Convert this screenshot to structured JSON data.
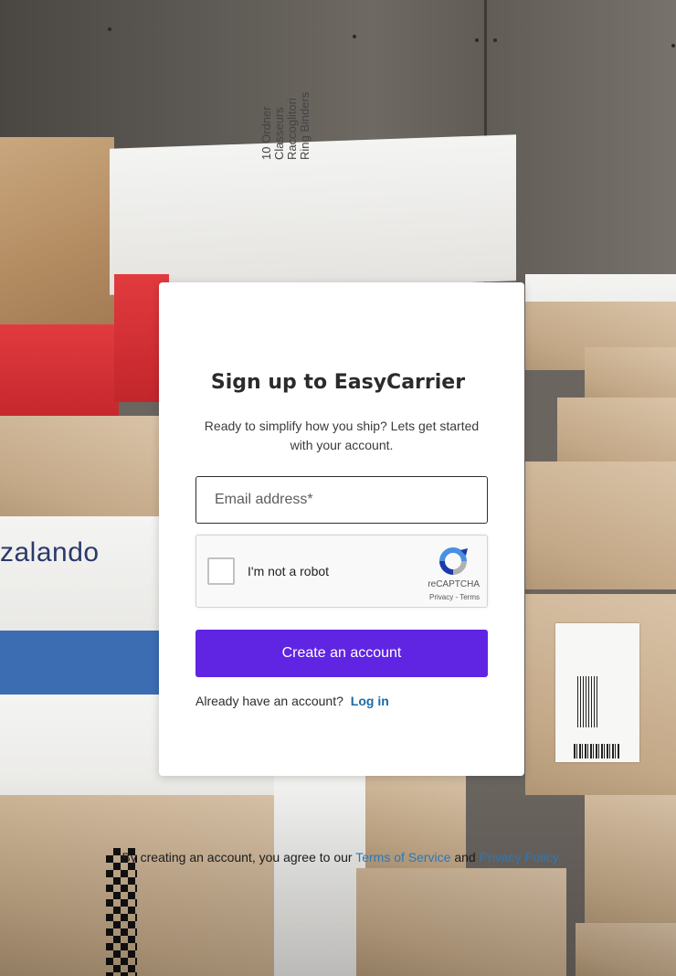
{
  "signup": {
    "title": "Sign up to EasyCarrier",
    "subtitle": "Ready to simplify how you ship? Lets get started with your account.",
    "email_placeholder": "Email address*",
    "captcha": {
      "label": "I'm not a robot",
      "brand": "reCAPTCHA",
      "privacy": "Privacy",
      "separator": " - ",
      "terms": "Terms",
      "checked": false
    },
    "create_button": "Create an account",
    "login_prompt": "Already have an account?",
    "login_link": "Log in"
  },
  "footer": {
    "prefix": "By creating an account, you agree to our ",
    "terms_link": "Terms of Service",
    "conjunction": " and ",
    "privacy_link": "Privacy Policy."
  },
  "background": {
    "box_text_zalando": "zalando",
    "box_text_ordner": "10 Ordner Classeurs Raccoglitori Ring Binders"
  },
  "colors": {
    "primary_button": "#6024e3",
    "link": "#1c6aa6"
  }
}
